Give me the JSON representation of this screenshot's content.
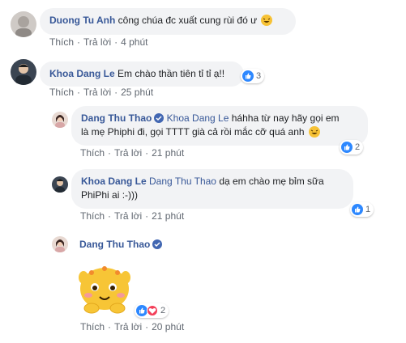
{
  "comments": [
    {
      "name": "Duong Tu Anh",
      "text": "công chúa đc xuất cung rùi đó ư",
      "like": "Thích",
      "reply": "Trả lời",
      "time": "4 phút"
    },
    {
      "name": "Khoa Dang Le",
      "text": "Em chào thần tiên tỉ tỉ ạ!!",
      "reactions": "3",
      "like": "Thích",
      "reply": "Trả lời",
      "time": "25 phút"
    },
    {
      "name": "Dang Thu Thao",
      "tag": "Khoa Dang Le",
      "text_line1": "háhha từ nay hãy gọi em",
      "text_line2": "là mẹ Phiphi đi, gọi TTTT già cả rồi mắc cỡ quá anh",
      "reactions": "2",
      "like": "Thích",
      "reply": "Trả lời",
      "time": "21 phút"
    },
    {
      "name": "Khoa Dang Le",
      "tag": "Dang Thu Thao",
      "text_line1": "dạ em chào mẹ bỉm sữa",
      "text_line2": "PhiPhi ai :-)))",
      "reactions": "1",
      "like": "Thích",
      "reply": "Trả lời",
      "time": "21 phút"
    },
    {
      "name": "Dang Thu Thao",
      "reactions": "2",
      "like": "Thích",
      "reply": "Trả lời",
      "time": "20 phút"
    }
  ],
  "colors": {
    "link_blue": "#385898",
    "bubble_bg": "#f2f3f5",
    "like_blue": "#2d88ff",
    "love_red": "#f33e58",
    "meta_gray": "#606770"
  },
  "icons": [
    "laughing-emoji-icon",
    "like-reaction-icon",
    "love-reaction-icon",
    "verified-badge-icon",
    "sticker-icon"
  ]
}
